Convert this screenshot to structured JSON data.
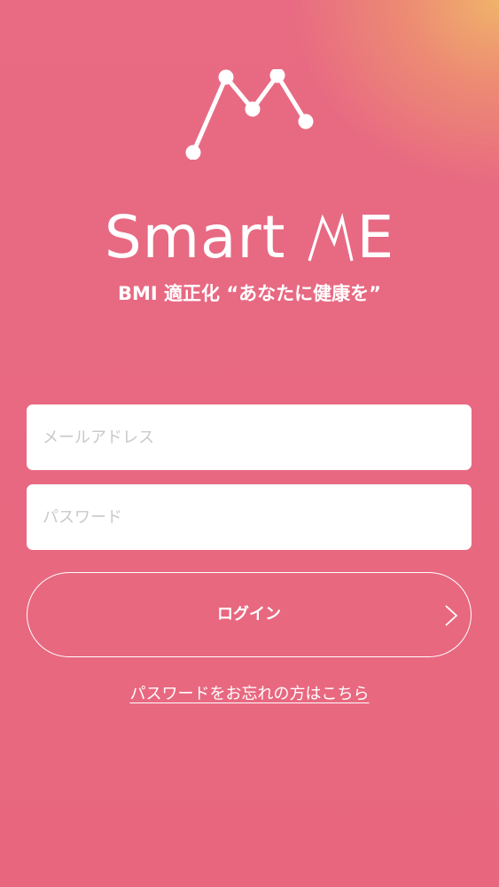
{
  "app": {
    "brand_prefix": "Smart",
    "brand_suffix": "E",
    "tagline": "BMI 適正化 “あなたに健康を”",
    "logo_icon": "graph-m-icon"
  },
  "login_form": {
    "email_placeholder": "メールアドレス",
    "password_placeholder": "パスワード",
    "login_label": "ログイン",
    "login_icon": "chevron-right-icon",
    "forgot_password_link": "パスワードをお忘れの方はこちら"
  },
  "colors": {
    "background": "#e8687f",
    "accent_corner": "#f0b36a",
    "text": "#ffffff",
    "input_background": "#ffffff",
    "placeholder": "#c9c9c9"
  }
}
